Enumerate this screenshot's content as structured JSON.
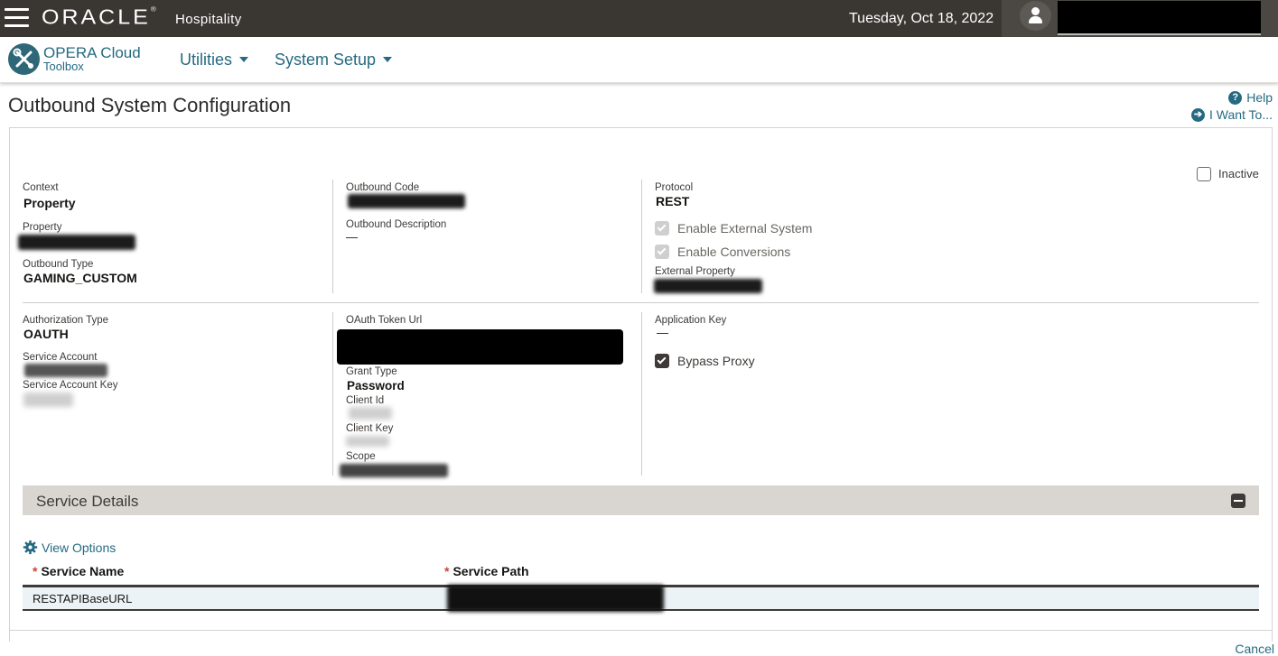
{
  "topbar": {
    "logo": "ORACLE",
    "product": "Hospitality",
    "date": "Tuesday, Oct 18, 2022"
  },
  "app": {
    "title": "OPERA Cloud",
    "subtitle": "Toolbox",
    "menus": [
      "Utilities",
      "System Setup"
    ]
  },
  "page": {
    "title": "Outbound System Configuration",
    "help": "Help",
    "i_want_to": "I Want To..."
  },
  "config": {
    "inactive_label": "Inactive",
    "context_label": "Context",
    "context_value": "Property",
    "property_label": "Property",
    "outbound_type_label": "Outbound Type",
    "outbound_type_value": "GAMING_CUSTOM",
    "outbound_code_label": "Outbound Code",
    "outbound_description_label": "Outbound Description",
    "outbound_description_value": "—",
    "protocol_label": "Protocol",
    "protocol_value": "REST",
    "enable_external_system": "Enable External System",
    "enable_conversions": "Enable Conversions",
    "external_property_label": "External Property",
    "authorization_type_label": "Authorization Type",
    "authorization_type_value": "OAUTH",
    "service_account_label": "Service Account",
    "service_account_key_label": "Service Account Key",
    "oauth_token_url_label": "OAuth Token Url",
    "grant_type_label": "Grant Type",
    "grant_type_value": "Password",
    "client_id_label": "Client Id",
    "client_key_label": "Client Key",
    "scope_label": "Scope",
    "application_key_label": "Application Key",
    "application_key_value": "—",
    "bypass_proxy": "Bypass Proxy"
  },
  "service_details": {
    "title": "Service Details",
    "view_options": "View Options",
    "required_marker": "*",
    "columns": [
      "Service Name",
      "Service Path"
    ],
    "rows": [
      {
        "service_name": "RESTAPIBaseURL"
      }
    ]
  },
  "footer": {
    "cancel": "Cancel"
  }
}
